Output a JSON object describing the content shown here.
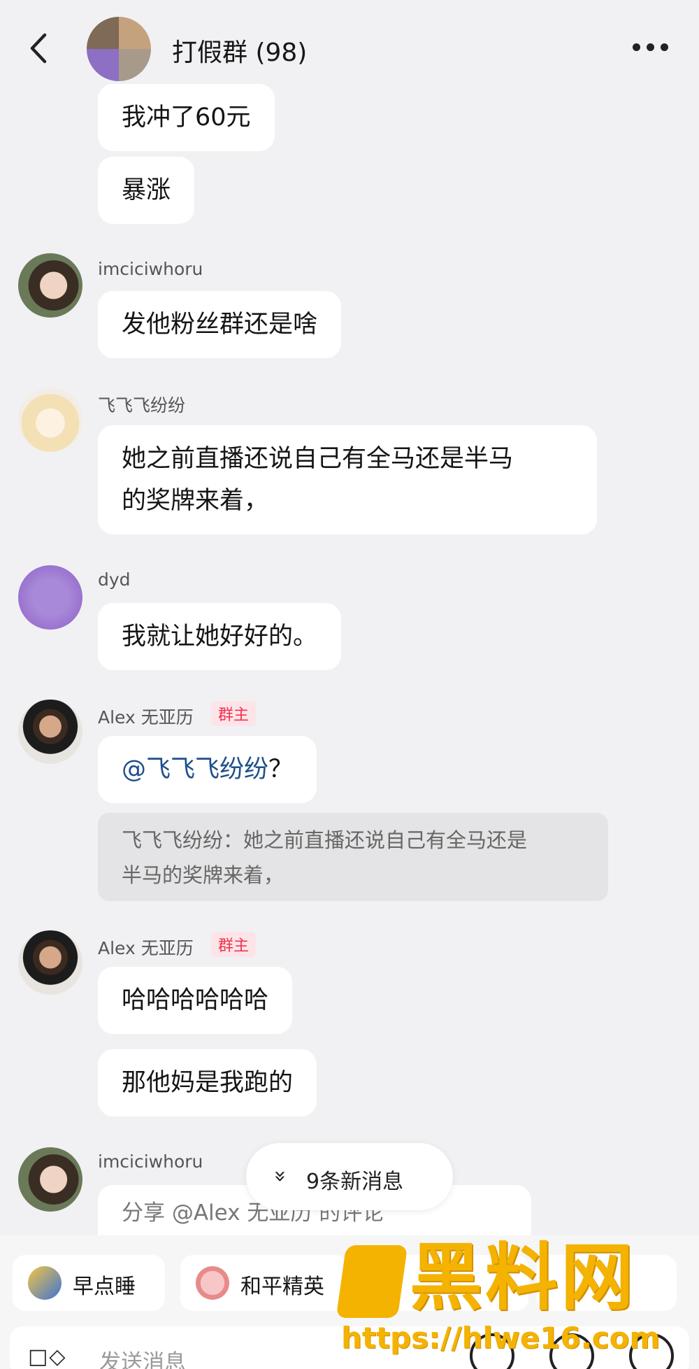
{
  "header": {
    "title": "打假群 (98)"
  },
  "messages": {
    "m1": "我冲了60元",
    "m2": "暴涨",
    "s1": "imciciwhoru",
    "m3": "发他粉丝群还是啥",
    "s2": "飞飞飞纷纷",
    "m4_line1": "她之前直播还说自己有全马还是半马",
    "m4_line2": "的奖牌来着，",
    "s3": "dyd",
    "m5": "我就让她好好的。",
    "s4": "Alex 无亚历",
    "badge": "群主",
    "m6_mention": "@飞飞飞纷纷",
    "m6_rest": "？",
    "quote_line1": "飞飞飞纷纷：她之前直播还说自己有全马还是",
    "quote_line2": "半马的奖牌来着，",
    "s5": "Alex 无亚历",
    "m7": "哈哈哈哈哈哈",
    "m8": "那他妈是我跑的",
    "s6": "imciciwhoru",
    "m9": "分享 @Alex 无亚历 的评论"
  },
  "new_messages": {
    "label": "9条新消息",
    "chevron": "»"
  },
  "chips": [
    {
      "label": "早点睡",
      "icon": "moon-icon"
    },
    {
      "label": "和平精英",
      "icon": "game-icon"
    }
  ],
  "input": {
    "placeholder": "发送消息"
  },
  "watermark": {
    "brand": "黑料网",
    "url": "https://hlwe16.com"
  },
  "colors": {
    "accent_mention": "#1e4f8c",
    "badge": "#f0334f",
    "watermark": "#f4b300"
  }
}
